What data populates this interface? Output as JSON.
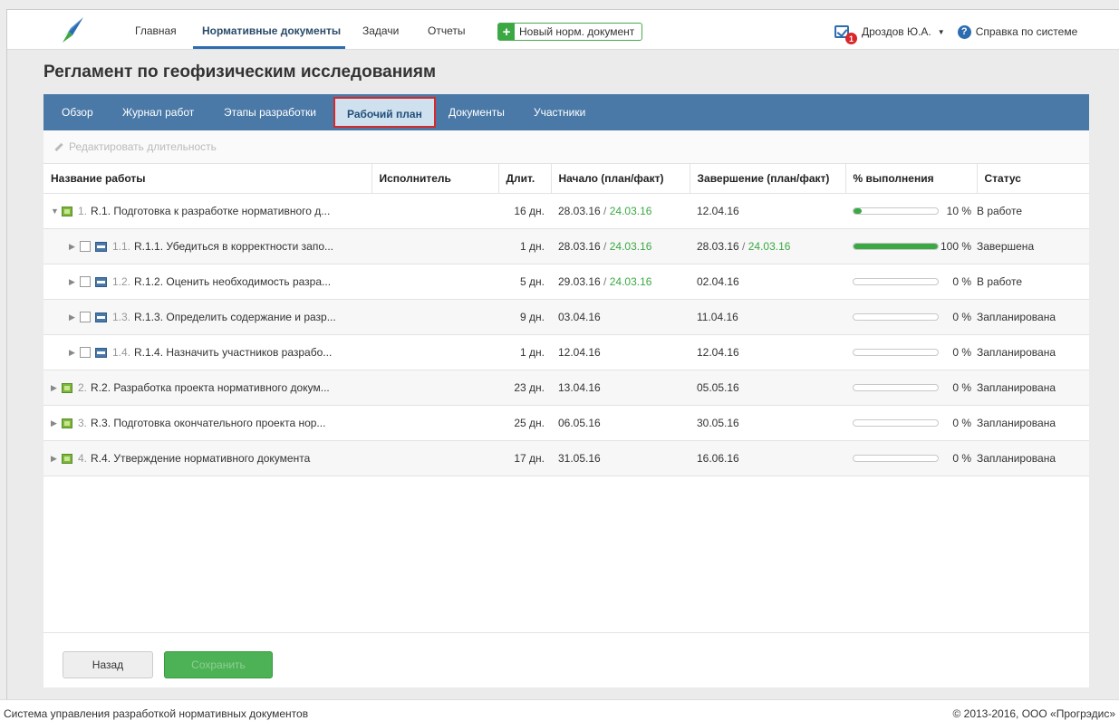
{
  "nav": {
    "items": [
      "Главная",
      "Нормативные документы",
      "Задачи",
      "Отчеты"
    ],
    "new_doc": "Новый норм. документ",
    "user": "Дроздов Ю.А.",
    "notifications": "1",
    "help": "Справка по системе"
  },
  "page_title": "Регламент по геофизическим исследованиям",
  "tabs": [
    "Обзор",
    "Журнал работ",
    "Этапы разработки",
    "Рабочий план",
    "Документы",
    "Участники"
  ],
  "active_tab": "Рабочий план",
  "toolbar": {
    "edit_duration": "Редактировать длительность"
  },
  "table": {
    "headers": {
      "name": "Название работы",
      "executor": "Исполнитель",
      "duration": "Длит.",
      "start": "Начало (план/факт)",
      "end": "Завершение (план/факт)",
      "progress": "% выполнения",
      "status": "Статус"
    },
    "rows": [
      {
        "num": "1.",
        "name": "R.1. Подготовка к разработке нормативного д...",
        "executor": "",
        "duration": "16 дн.",
        "start_plan": "28.03.16",
        "start_fact": "24.03.16",
        "end_plan": "12.04.16",
        "end_fact": "",
        "progress_label": "10 %",
        "progress": 10,
        "status": "В работе"
      },
      {
        "num": "1.1.",
        "name": "R.1.1. Убедиться в корректности запо...",
        "executor": "",
        "duration": "1 дн.",
        "start_plan": "28.03.16",
        "start_fact": "24.03.16",
        "end_plan": "28.03.16",
        "end_fact": "24.03.16",
        "progress_label": "100 %",
        "progress": 100,
        "status": "Завершена"
      },
      {
        "num": "1.2.",
        "name": "R.1.2. Оценить необходимость разра...",
        "executor": "",
        "duration": "5 дн.",
        "start_plan": "29.03.16",
        "start_fact": "24.03.16",
        "end_plan": "02.04.16",
        "end_fact": "",
        "progress_label": "0 %",
        "progress": 0,
        "status": "В работе"
      },
      {
        "num": "1.3.",
        "name": "R.1.3. Определить содержание и разр...",
        "executor": "",
        "duration": "9 дн.",
        "start_plan": "03.04.16",
        "start_fact": "",
        "end_plan": "11.04.16",
        "end_fact": "",
        "progress_label": "0 %",
        "progress": 0,
        "status": "Запланирована"
      },
      {
        "num": "1.4.",
        "name": "R.1.4. Назначить участников разрабо...",
        "executor": "",
        "duration": "1 дн.",
        "start_plan": "12.04.16",
        "start_fact": "",
        "end_plan": "12.04.16",
        "end_fact": "",
        "progress_label": "0 %",
        "progress": 0,
        "status": "Запланирована"
      },
      {
        "num": "2.",
        "name": "R.2. Разработка проекта нормативного докум...",
        "executor": "",
        "duration": "23 дн.",
        "start_plan": "13.04.16",
        "start_fact": "",
        "end_plan": "05.05.16",
        "end_fact": "",
        "progress_label": "0 %",
        "progress": 0,
        "status": "Запланирована"
      },
      {
        "num": "3.",
        "name": "R.3. Подготовка окончательного проекта нор...",
        "executor": "",
        "duration": "25 дн.",
        "start_plan": "06.05.16",
        "start_fact": "",
        "end_plan": "30.05.16",
        "end_fact": "",
        "progress_label": "0 %",
        "progress": 0,
        "status": "Запланирована"
      },
      {
        "num": "4.",
        "name": "R.4. Утверждение нормативного документа",
        "executor": "",
        "duration": "17 дн.",
        "start_plan": "31.05.16",
        "start_fact": "",
        "end_plan": "16.06.16",
        "end_fact": "",
        "progress_label": "0 %",
        "progress": 0,
        "status": "Запланирована"
      }
    ]
  },
  "buttons": {
    "back": "Назад",
    "save": "Сохранить"
  },
  "footer": {
    "left": "Система управления разработкой нормативных документов",
    "right": "© 2013-2016, ООО «Прогрэдис»"
  },
  "colors": {
    "accent": "#4a79a8",
    "green": "#3ba844",
    "highlight": "#d42a2a"
  }
}
